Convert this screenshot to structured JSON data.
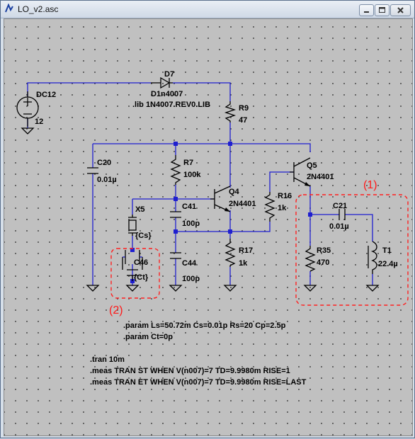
{
  "window": {
    "title": "LO_v2.asc",
    "controls": [
      "minimize-icon",
      "maximize-icon",
      "close-icon"
    ]
  },
  "components": {
    "dc12": {
      "name": "DC12",
      "value": "12"
    },
    "d7": {
      "name": "D7",
      "model": "D1n4007",
      "lib": ".lib 1N4007.REV0.LIB"
    },
    "r9": {
      "name": "R9",
      "value": "47"
    },
    "c20": {
      "name": "C20",
      "value": "0.01µ"
    },
    "r7": {
      "name": "R7",
      "value": "100k"
    },
    "q4": {
      "name": "Q4",
      "model": "2N4401"
    },
    "q5": {
      "name": "Q5",
      "model": "2N4401"
    },
    "r16": {
      "name": "R16",
      "value": "1k"
    },
    "x5": {
      "name": "X5",
      "value": "{Cs}"
    },
    "c41": {
      "name": "C41",
      "value": "100p"
    },
    "c46": {
      "name": "C46",
      "value": "{Ct}"
    },
    "c44": {
      "name": "C44",
      "value": "100p"
    },
    "r17": {
      "name": "R17",
      "value": "1k"
    },
    "c21": {
      "name": "C21",
      "value": "0.01µ"
    },
    "r35": {
      "name": "R35",
      "value": "470"
    },
    "t1": {
      "name": "T1",
      "value": "22.4µ"
    }
  },
  "annotations": {
    "box1_label": "(1)",
    "box2_label": "(2)"
  },
  "directives": {
    "param1": ".param Ls=50.72m Cs=0.01p Rs=20 Cp=2.5p",
    "param2": ".param Ct=0p",
    "tran": ".tran 10m",
    "meas1": ".meas TRAN ST WHEN V(n007)=7 TD=9.9980m RISE=1",
    "meas2": ".meas TRAN ET WHEN V(n007)=7 TD=9.9980m RISE=LAST"
  }
}
